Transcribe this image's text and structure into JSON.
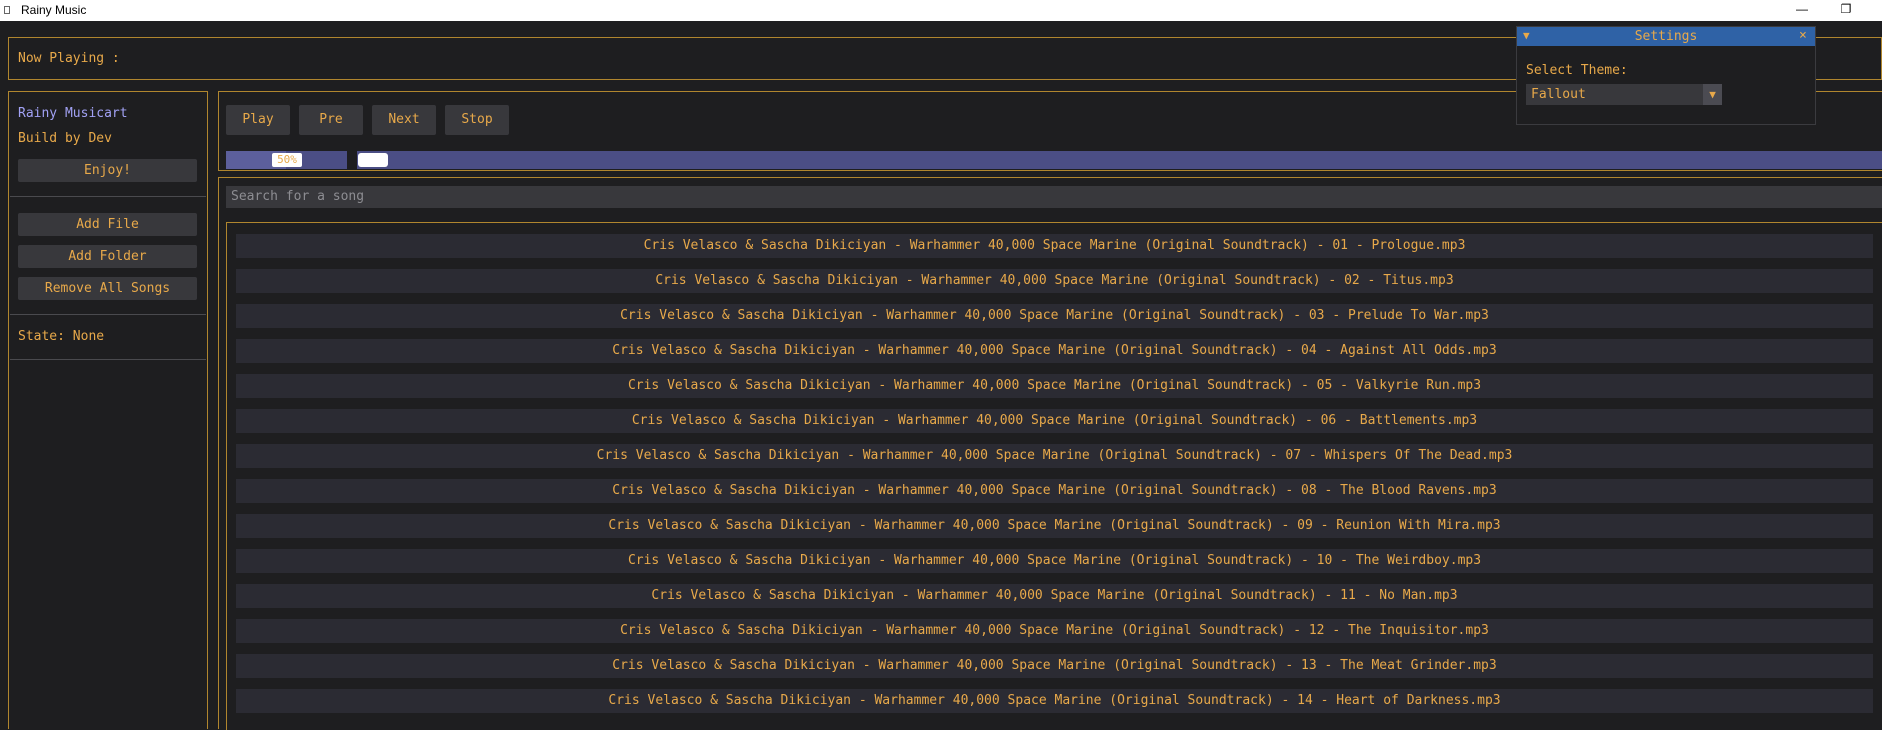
{
  "window": {
    "title": "Rainy Music",
    "minimize": "—",
    "restore": "❐"
  },
  "now_playing": {
    "label": "Now Playing :"
  },
  "sidebar": {
    "brand": "Rainy Musicart",
    "build": "Build by Dev",
    "enjoy": "Enjoy!",
    "add_file": "Add File",
    "add_folder": "Add Folder",
    "remove_all": "Remove All Songs",
    "state": "State: None"
  },
  "controls": {
    "play": "Play",
    "pre": "Pre",
    "next": "Next",
    "stop": "Stop",
    "progress": 0.5,
    "progress_text": "50%"
  },
  "search": {
    "placeholder": "Search for a song"
  },
  "songs": [
    "Cris Velasco & Sascha Dikiciyan - Warhammer 40,000 Space Marine (Original Soundtrack) - 01 - Prologue.mp3",
    "Cris Velasco & Sascha Dikiciyan - Warhammer 40,000 Space Marine (Original Soundtrack) - 02 - Titus.mp3",
    "Cris Velasco & Sascha Dikiciyan - Warhammer 40,000 Space Marine (Original Soundtrack) - 03 - Prelude To War.mp3",
    "Cris Velasco & Sascha Dikiciyan - Warhammer 40,000 Space Marine (Original Soundtrack) - 04 - Against All Odds.mp3",
    "Cris Velasco & Sascha Dikiciyan - Warhammer 40,000 Space Marine (Original Soundtrack) - 05 - Valkyrie Run.mp3",
    "Cris Velasco & Sascha Dikiciyan - Warhammer 40,000 Space Marine (Original Soundtrack) - 06 - Battlements.mp3",
    "Cris Velasco & Sascha Dikiciyan - Warhammer 40,000 Space Marine (Original Soundtrack) - 07 - Whispers Of The Dead.mp3",
    "Cris Velasco & Sascha Dikiciyan - Warhammer 40,000 Space Marine (Original Soundtrack) - 08 - The Blood Ravens.mp3",
    "Cris Velasco & Sascha Dikiciyan - Warhammer 40,000 Space Marine (Original Soundtrack) - 09 - Reunion With Mira.mp3",
    "Cris Velasco & Sascha Dikiciyan - Warhammer 40,000 Space Marine (Original Soundtrack) - 10 - The Weirdboy.mp3",
    "Cris Velasco & Sascha Dikiciyan - Warhammer 40,000 Space Marine (Original Soundtrack) - 11 - No Man.mp3",
    "Cris Velasco & Sascha Dikiciyan - Warhammer 40,000 Space Marine (Original Soundtrack) - 12 - The Inquisitor.mp3",
    "Cris Velasco & Sascha Dikiciyan - Warhammer 40,000 Space Marine (Original Soundtrack) - 13 - The Meat Grinder.mp3",
    "Cris Velasco & Sascha Dikiciyan - Warhammer 40,000 Space Marine (Original Soundtrack) - 14 - Heart of Darkness.mp3"
  ],
  "settings": {
    "title": "Settings",
    "collapse_icon": "▼",
    "close_icon": "×",
    "theme_label": "Select Theme:",
    "theme_value": "Fallout",
    "dropdown_icon": "▼"
  },
  "colors": {
    "accent_text": "#e8a94a",
    "brand_text": "#a2a2f5",
    "settings_header": "#2f62a6",
    "progress_track": "#4b4e85"
  }
}
